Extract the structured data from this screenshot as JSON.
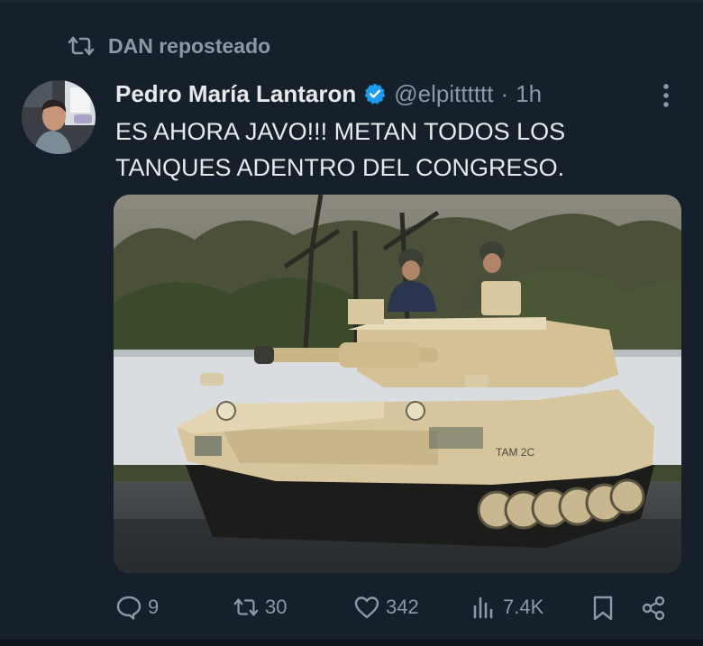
{
  "repost": {
    "label": "DAN reposteado"
  },
  "tweet": {
    "author_name": "Pedro María Lantaron",
    "handle": "@elpitttttt",
    "separator": "·",
    "time": "1h",
    "text": "ES AHORA JAVO!!! METAN TODOS LOS\nTANQUES ADENTRO DEL CONGRESO.",
    "media_description": "Tan-colored military tank driving on a road with two helmeted people in the turret, trees and a white wall behind",
    "tank_marking": "TAM 2C"
  },
  "actions": {
    "replies": "9",
    "reposts": "30",
    "likes": "342",
    "views": "7.4K"
  },
  "colors": {
    "background": "#15202b",
    "text": "#e7e9ea",
    "muted": "#8b98a5",
    "verified": "#1d9bf0"
  }
}
